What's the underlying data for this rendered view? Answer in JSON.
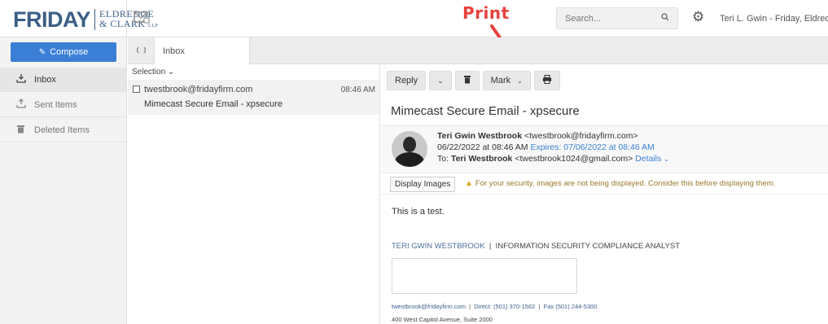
{
  "logo": {
    "main": "FRIDAY",
    "line1": "ELDREDGE",
    "line2": "& CLARK",
    "suffix": "LLP"
  },
  "annotation": {
    "label": "Print"
  },
  "search": {
    "placeholder": "Search..."
  },
  "user": {
    "name": "Teri L. Gwin - Friday, Eldredge"
  },
  "sidebar": {
    "compose_label": "Compose",
    "items": [
      {
        "label": "Inbox",
        "active": true
      },
      {
        "label": "Sent Items",
        "active": false
      },
      {
        "label": "Deleted Items",
        "active": false
      }
    ]
  },
  "tabs": {
    "inbox_label": "Inbox"
  },
  "list": {
    "selection_label": "Selection",
    "messages": [
      {
        "from": "twestbrook@fridayfirm.com",
        "time": "08:46 AM",
        "subject": "Mimecast Secure Email - xpsecure"
      }
    ]
  },
  "toolbar": {
    "reply_label": "Reply",
    "mark_label": "Mark"
  },
  "message": {
    "subject": "Mimecast Secure Email - xpsecure",
    "from_name": "Teri Gwin Westbrook",
    "from_email": "<twestbrook@fridayfirm.com>",
    "date": "06/22/2022 at 08:46 AM",
    "expires": "Expires: 07/06/2022 at 08:46 AM",
    "to_prefix": "To:",
    "to_name": "Teri Westbrook",
    "to_email": "<twestbrook1024@gmail.com>",
    "details_label": "Details",
    "display_images_label": "Display Images",
    "warning": "For your security, images are not being displayed. Consider this before displaying them.",
    "body": "This is a test.",
    "sig_name": "TERI GWIN WESTBROOK",
    "sig_sep": "|",
    "sig_title": "INFORMATION SECURITY COMPLIANCE ANALYST",
    "contact_email": "twestbrook@fridayfirm.com",
    "contact_direct": "Direct: (501) 370-1562",
    "contact_fax": "Fax (501) 244-5300",
    "address": "400 West Capitol Avenue, Suite 2000"
  },
  "colors": {
    "accent": "#3a7fd5",
    "annotation": "#e8413c",
    "brand": "#3b5f86"
  }
}
